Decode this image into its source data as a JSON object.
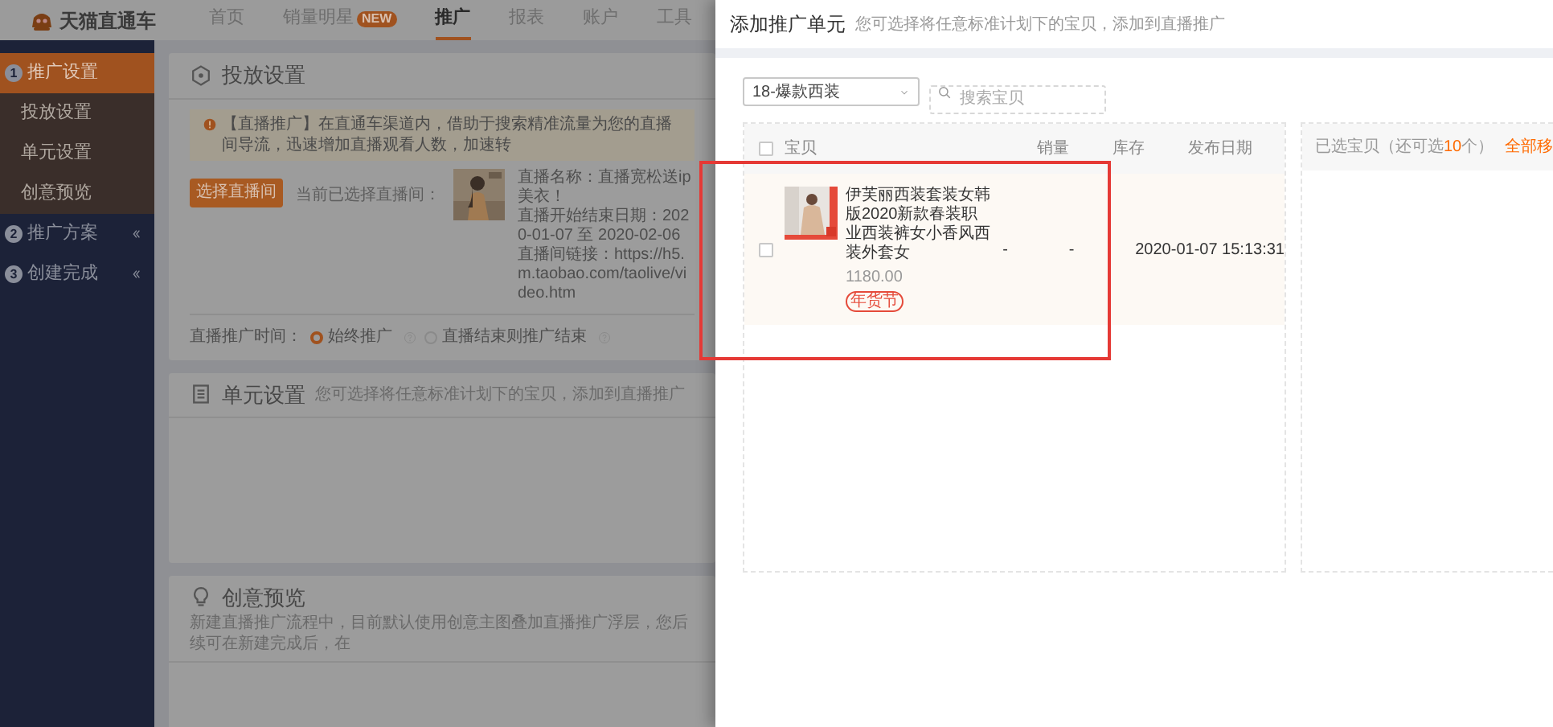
{
  "app": {
    "logo": "天猫直通车"
  },
  "nav": [
    {
      "label": "首页",
      "selected": false
    },
    {
      "label": "销量明星",
      "badge": "NEW",
      "selected": false
    },
    {
      "label": "推广",
      "selected": true
    },
    {
      "label": "报表",
      "selected": false
    },
    {
      "label": "账户",
      "selected": false
    },
    {
      "label": "工具",
      "selected": false
    }
  ],
  "sidebar": [
    {
      "number": "1",
      "label": "推广设置",
      "selected": true,
      "expanded": true,
      "children": [
        {
          "label": "投放设置"
        },
        {
          "label": "单元设置"
        },
        {
          "label": "创意预览"
        }
      ]
    },
    {
      "number": "2",
      "label": "推广方案",
      "selected": false,
      "expanded": false
    },
    {
      "number": "3",
      "label": "创建完成",
      "selected": false,
      "expanded": false
    }
  ],
  "sections": [
    {
      "kind": "delivery",
      "title": "投放设置",
      "notice": "【直播推广】在直通车渠道内，借助于搜索精准流量为您的直播间导流，迅速增加直播观看人数，加速转",
      "button": "选择直播间",
      "current_label": "当前已选择直播间：",
      "live_info": [
        "直播名称：直播宽松送ip美衣！",
        "直播开始结束日期：2020-01-07 至 2020-02-06",
        "直播间链接：https://h5.m.taobao.com/taolive/video.htm"
      ],
      "time_label": "直播推广时间：",
      "time_options": [
        {
          "label": "始终推广",
          "selected": true
        },
        {
          "label": "直播结束则推广结束",
          "selected": false
        }
      ]
    },
    {
      "kind": "unit",
      "title": "单元设置",
      "description": "您可选择将任意标准计划下的宝贝，添加到直播推广"
    },
    {
      "kind": "creative",
      "title": "创意预览",
      "description": "新建直播推广流程中，目前默认使用创意主图叠加直播推广浮层，您后续可在新建完成后，在"
    }
  ],
  "drawer": {
    "title": "添加推广单元",
    "subtitle": "您可选择将任意标准计划下的宝贝，添加到直播推广",
    "plan_select": "18-爆款西装",
    "search": {
      "placeholder": "搜索宝贝"
    },
    "table": {
      "header_checked": false,
      "columns": [
        "宝贝",
        "销量",
        "库存",
        "发布日期"
      ],
      "rows": [
        {
          "checked": false,
          "title": "伊芙丽西装套装女韩版2020新款春装职业西装裤女小香风西装外套女",
          "price": "1180.00",
          "tag": "年货节",
          "sales": "-",
          "stock": "-",
          "date": "2020-01-07 15:13:31"
        }
      ]
    },
    "selected_panel": {
      "title": "已选宝贝（还可选**10**个）",
      "action": "全部移"
    }
  }
}
